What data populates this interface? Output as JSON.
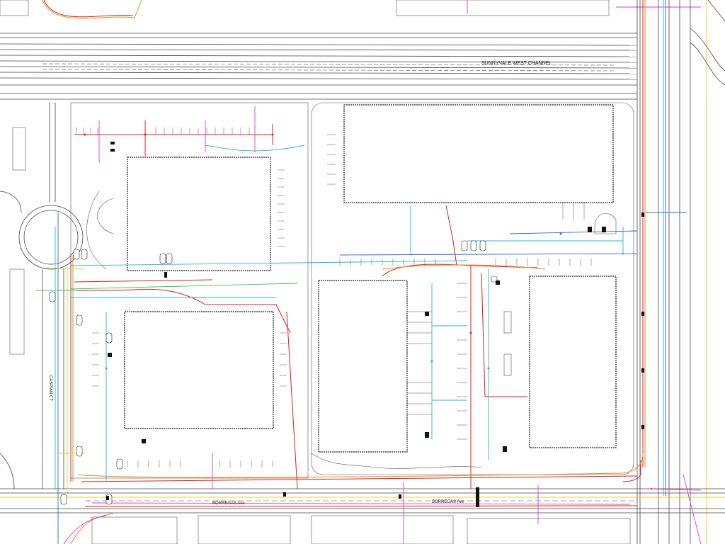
{
  "labels": {
    "channel": "SUNNYVALE WEST CHANNEL",
    "street_south_left": "BORREGAS Ave",
    "street_south_right": "BORREGAS Ave",
    "street_west": "CASPIAN CT"
  },
  "colors": {
    "red": "#e0201a",
    "orange": "#f08a1a",
    "cyan": "#22b8c8",
    "blue": "#2a66e0",
    "magenta": "#e03ad0",
    "green": "#3ac84a",
    "yellow": "#e6d320"
  }
}
